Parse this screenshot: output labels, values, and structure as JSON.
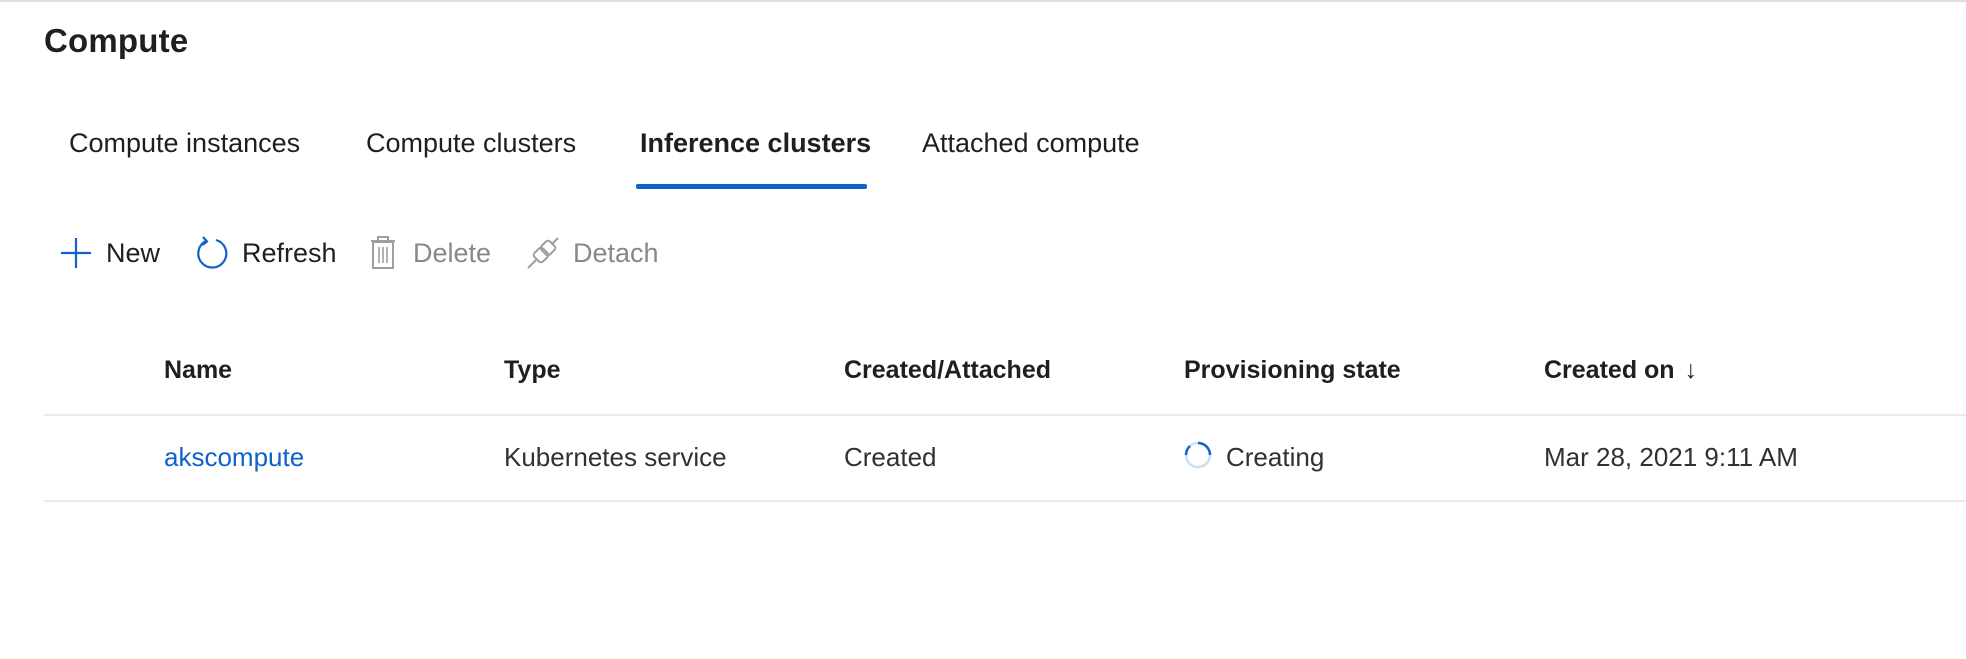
{
  "page": {
    "title": "Compute"
  },
  "tabs": [
    {
      "label": "Compute instances",
      "active": false
    },
    {
      "label": "Compute clusters",
      "active": false
    },
    {
      "label": "Inference clusters",
      "active": true
    },
    {
      "label": "Attached compute",
      "active": false
    }
  ],
  "toolbar": {
    "new_label": "New",
    "refresh_label": "Refresh",
    "delete_label": "Delete",
    "detach_label": "Detach",
    "new_icon": "plus-icon",
    "refresh_icon": "refresh-icon",
    "delete_icon": "trash-icon",
    "detach_icon": "plug-icon"
  },
  "table": {
    "columns": [
      "Name",
      "Type",
      "Created/Attached",
      "Provisioning state",
      "Created on"
    ],
    "sort_indicator": "↓",
    "rows": [
      {
        "name": "akscompute",
        "type": "Kubernetes service",
        "created_attached": "Created",
        "provisioning_state": "Creating",
        "created_on": "Mar 28, 2021 9:11 AM"
      }
    ]
  },
  "colors": {
    "accent": "#0f62c9",
    "disabled": "#8a8886",
    "text": "#201f1e"
  }
}
